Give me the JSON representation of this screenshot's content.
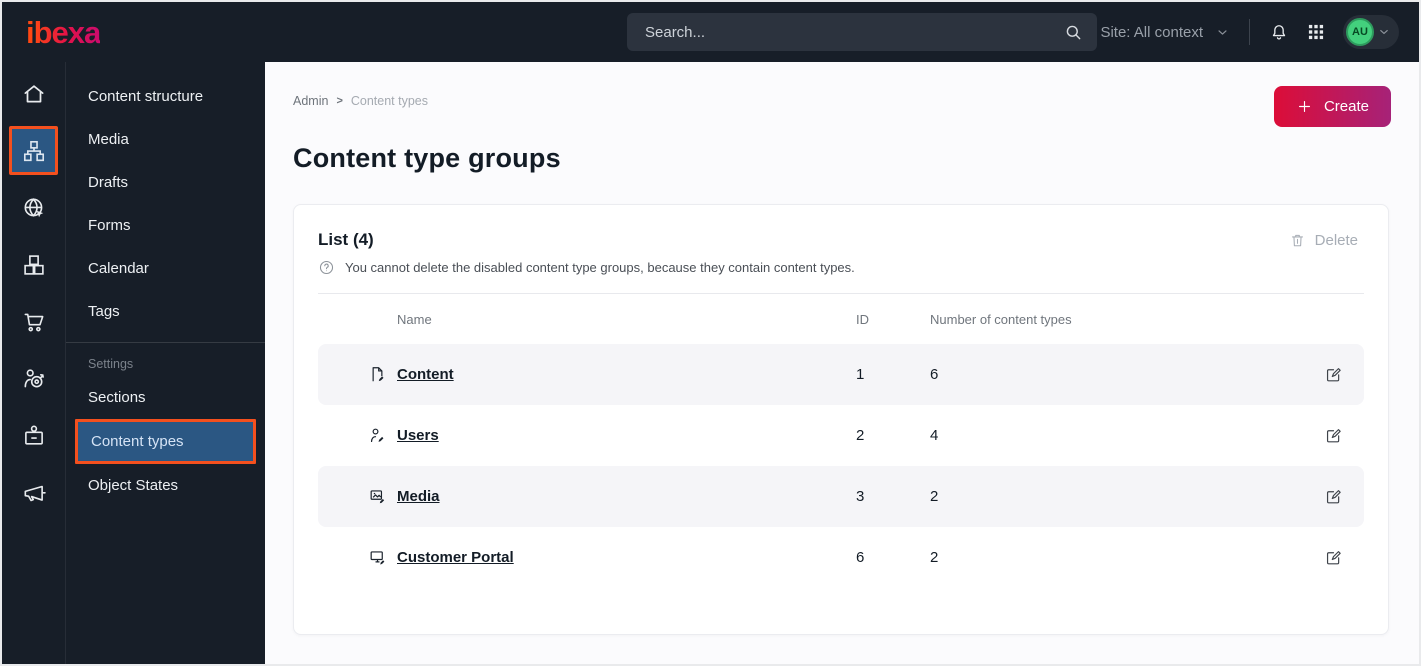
{
  "colors": {
    "topbar-bg": "#171e28",
    "page-bg": "#fbfbfd",
    "stripe-bg": "#f5f5f8",
    "text-dark": "#131c26",
    "accent-orange": "#f4501e",
    "selected-blue": "#2b5783",
    "avatar-green": "#43d07d",
    "logo-grad-start": "#ff4713",
    "logo-grad-end": "#cb0c6e",
    "create-grad-start": "#dc0d38",
    "create-grad-end": "#a62278"
  },
  "topbar": {
    "logo": "ibexa",
    "search_placeholder": "Search...",
    "site_context_label": "Site: All context",
    "avatar_initials": "AU"
  },
  "icon_rail": {
    "items": [
      {
        "icon": "home-icon",
        "active": false
      },
      {
        "icon": "content-structure-sitemap-icon",
        "active": true
      },
      {
        "icon": "site-globe-cursor-icon",
        "active": false
      },
      {
        "icon": "product-boxes-icon",
        "active": false
      },
      {
        "icon": "commerce-cart-icon",
        "active": false
      },
      {
        "icon": "personalization-target-icon",
        "active": false
      },
      {
        "icon": "admin-badge-icon",
        "active": false
      },
      {
        "icon": "campaign-megaphone-icon",
        "active": false
      }
    ]
  },
  "sidebar": {
    "items": [
      "Content structure",
      "Media",
      "Drafts",
      "Forms",
      "Calendar",
      "Tags"
    ],
    "settings_label": "Settings",
    "settings_items": [
      "Sections",
      "Content types",
      "Object States"
    ],
    "active_item": "Content types"
  },
  "main": {
    "breadcrumb": {
      "items": [
        "Admin",
        "Content types"
      ],
      "separator": ">"
    },
    "create_button": "Create",
    "page_title": "Content type groups",
    "card": {
      "list_title": "List (4)",
      "help_text": "You cannot delete the disabled content type groups, because they contain content types.",
      "delete_button": "Delete",
      "table": {
        "headers": {
          "name": "Name",
          "id": "ID",
          "count": "Number of content types"
        },
        "rows": [
          {
            "icon": "content-file-icon",
            "name": "Content",
            "id": "1",
            "count": "6"
          },
          {
            "icon": "users-person-icon",
            "name": "Users",
            "id": "2",
            "count": "4"
          },
          {
            "icon": "media-image-icon",
            "name": "Media",
            "id": "3",
            "count": "2"
          },
          {
            "icon": "customer-portal-screen-icon",
            "name": "Customer Portal",
            "id": "6",
            "count": "2"
          }
        ]
      }
    }
  }
}
